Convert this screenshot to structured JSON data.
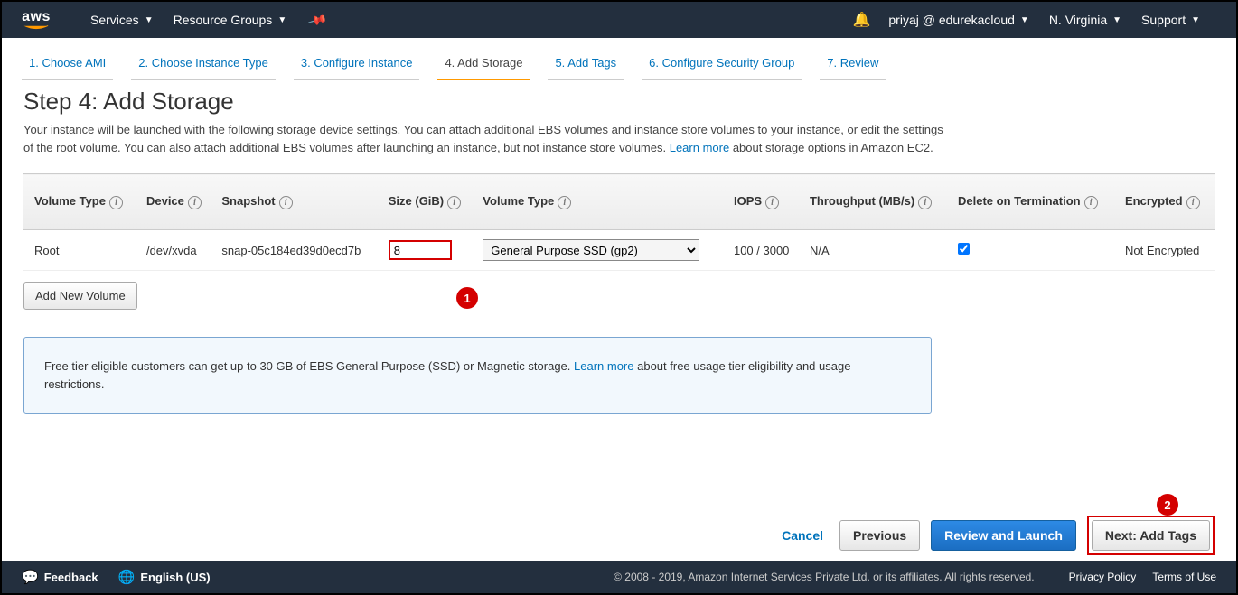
{
  "nav": {
    "logo": "aws",
    "services": "Services",
    "resource_groups": "Resource Groups",
    "account": "priyaj @ edurekacloud",
    "region": "N. Virginia",
    "support": "Support"
  },
  "tabs": [
    {
      "label": "1. Choose AMI"
    },
    {
      "label": "2. Choose Instance Type"
    },
    {
      "label": "3. Configure Instance"
    },
    {
      "label": "4. Add Storage",
      "active": true
    },
    {
      "label": "5. Add Tags"
    },
    {
      "label": "6. Configure Security Group"
    },
    {
      "label": "7. Review"
    }
  ],
  "step": {
    "title": "Step 4: Add Storage",
    "desc1": "Your instance will be launched with the following storage device settings. You can attach additional EBS volumes and instance store volumes to your instance, or edit the settings of the root volume. You can also attach additional EBS volumes after launching an instance, but not instance store volumes. ",
    "learn_more": "Learn more",
    "desc2": " about storage options in Amazon EC2."
  },
  "table": {
    "headers": {
      "voltype1": "Volume Type",
      "device": "Device",
      "snapshot": "Snapshot",
      "size": "Size (GiB)",
      "voltype2": "Volume Type",
      "iops": "IOPS",
      "throughput": "Throughput (MB/s)",
      "delete": "Delete on Termination",
      "encrypted": "Encrypted"
    },
    "row": {
      "voltype1": "Root",
      "device": "/dev/xvda",
      "snapshot": "snap-05c184ed39d0ecd7b",
      "size": "8",
      "voltype2": "General Purpose SSD (gp2)",
      "iops": "100 / 3000",
      "throughput": "N/A",
      "delete_checked": true,
      "encrypted": "Not Encrypted"
    },
    "add_volume": "Add New Volume"
  },
  "infobox": {
    "text1": "Free tier eligible customers can get up to 30 GB of EBS General Purpose (SSD) or Magnetic storage. ",
    "learn_more": "Learn more",
    "text2": " about free usage tier eligibility and usage restrictions."
  },
  "actions": {
    "cancel": "Cancel",
    "previous": "Previous",
    "review": "Review and Launch",
    "next": "Next: Add Tags"
  },
  "annotations": {
    "one": "1",
    "two": "2"
  },
  "footer": {
    "feedback": "Feedback",
    "language": "English (US)",
    "copyright": "© 2008 - 2019, Amazon Internet Services Private Ltd. or its affiliates. All rights reserved.",
    "privacy": "Privacy Policy",
    "terms": "Terms of Use"
  }
}
